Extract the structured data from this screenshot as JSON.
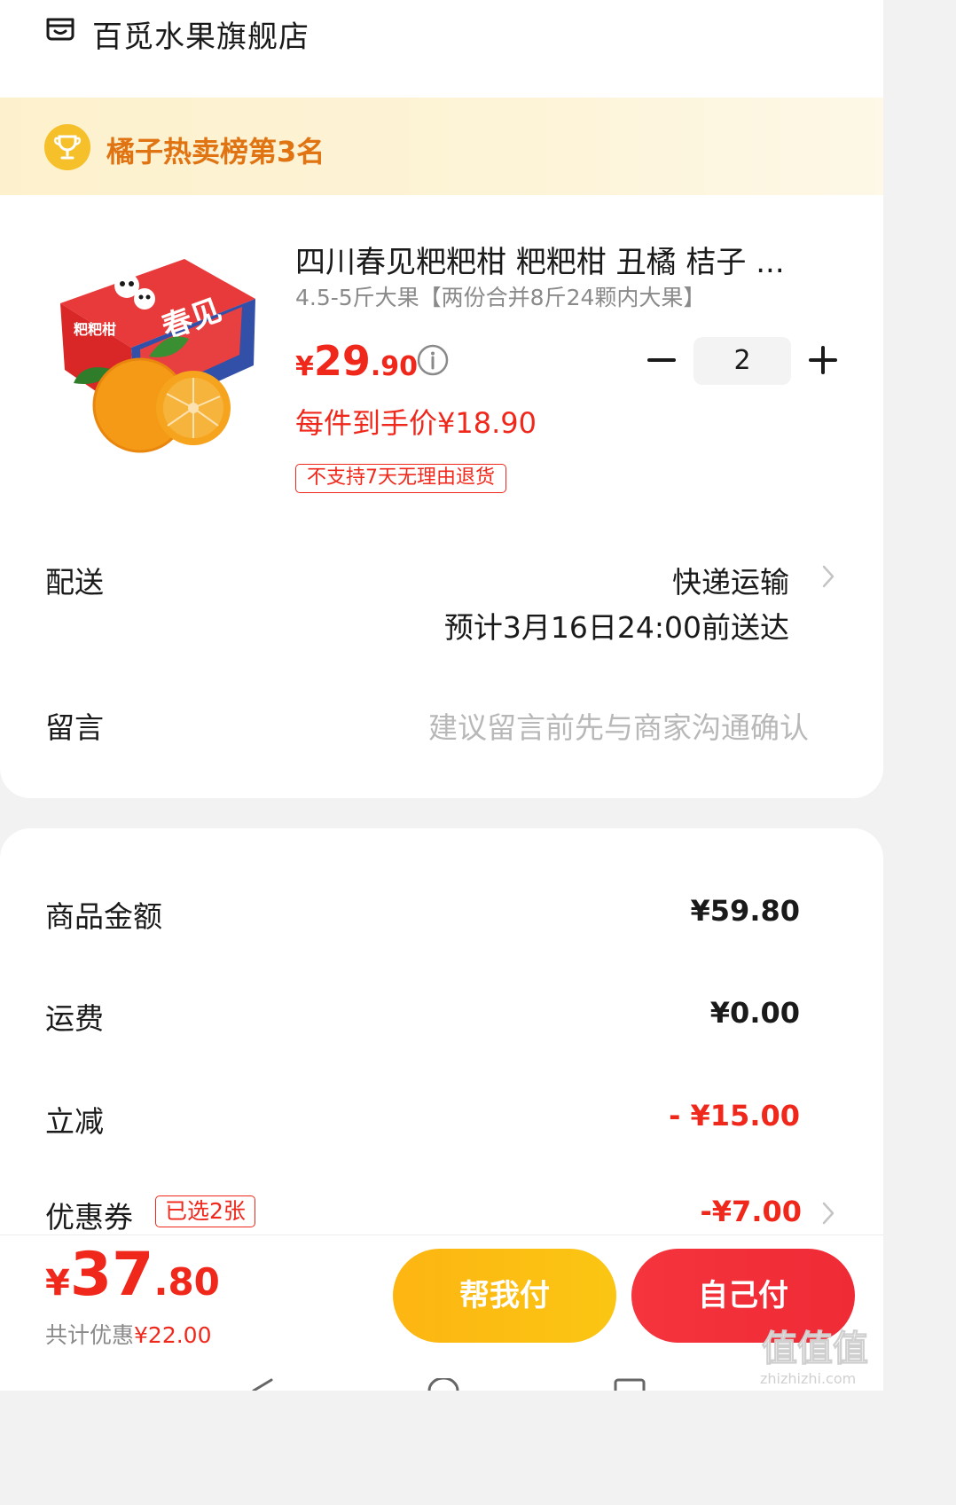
{
  "store": {
    "name": "百觅水果旗舰店",
    "icon": "store-icon"
  },
  "rank_banner": {
    "text": "橘子热卖榜第3名",
    "icon": "trophy-icon"
  },
  "product": {
    "title": "四川春见粑粑柑 粑粑柑 丑橘 桔子 ...",
    "spec": "4.5-5斤大果【两份合并8斤24颗内大果】",
    "price_currency": "¥",
    "price_int": "29",
    "price_dec": ".90",
    "unit_price": "每件到手价¥18.90",
    "return_policy": "不支持7天无理由退货",
    "quantity": "2"
  },
  "delivery": {
    "label": "配送",
    "method": "快递运输",
    "eta": "预计3月16日24:00前送达"
  },
  "note": {
    "label": "留言",
    "placeholder": "建议留言前先与商家沟通确认"
  },
  "summary": {
    "goods_label": "商品金额",
    "goods_value": "¥59.80",
    "shipping_label": "运费",
    "shipping_value": "¥0.00",
    "discount_label": "立减",
    "discount_value": "- ¥15.00",
    "coupon_label": "优惠券",
    "coupon_badge": "已选2张",
    "coupon_value": "-¥7.00"
  },
  "footer": {
    "total_currency": "¥",
    "total_int": "37",
    "total_dec": ".80",
    "discount_prefix": "共计优惠",
    "discount_amount": "¥22.00",
    "help_pay_label": "帮我付",
    "self_pay_label": "自己付"
  },
  "watermark": {
    "text": "值值值",
    "subtext": "zhizhizhi.com"
  },
  "colors": {
    "price_red": "#f0281c",
    "rank_orange": "#e07312",
    "help_pay_yellow": "#fdb512",
    "self_pay_red": "#f5343d"
  }
}
